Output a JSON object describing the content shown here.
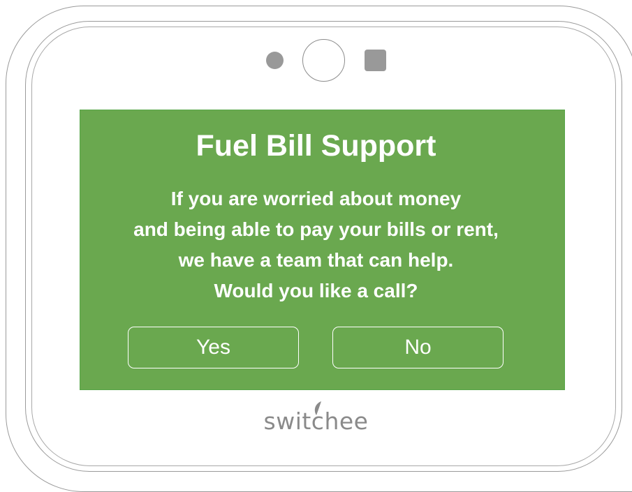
{
  "dialog": {
    "title": "Fuel Bill Support",
    "message_lines": [
      "If you are worried about money",
      "and being able to pay your bills or rent,",
      "we have a team that can help.",
      "Would you like a call?"
    ],
    "yes_label": "Yes",
    "no_label": "No"
  },
  "device": {
    "brand": "switchee"
  },
  "colors": {
    "screen_background": "#6aa84f",
    "text": "#ffffff",
    "device_outline": "#9a9a9a",
    "logo": "#8a8a8a"
  },
  "icons": {
    "sensor_left": "ambient-light-sensor-icon",
    "camera": "camera-lens-icon",
    "sensor_right": "square-sensor-icon",
    "logo_leaf": "leaf-icon"
  }
}
